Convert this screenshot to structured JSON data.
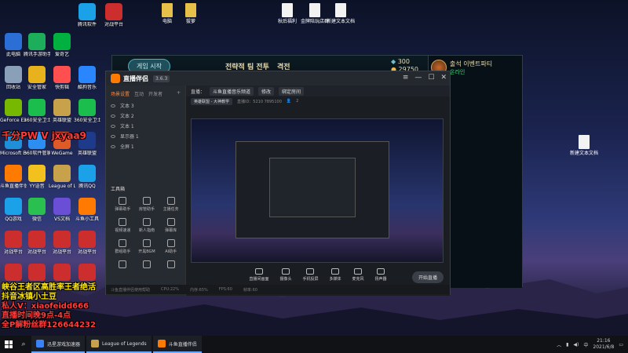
{
  "desktop": {
    "icons_col1": [
      {
        "label": "此电脑",
        "color": "#2b6fd6"
      },
      {
        "label": "回收站",
        "color": "#8aa0b8"
      },
      {
        "label": "GeForce Experience",
        "color": "#76b900"
      },
      {
        "label": "Microsoft Edge",
        "color": "#1e8fd8"
      },
      {
        "label": "斗鱼直播伴侣",
        "color": "#ff7a00"
      },
      {
        "label": "QQ游戏",
        "color": "#1aa1e8"
      },
      {
        "label": "对战平台",
        "color": "#cc2d2d"
      },
      {
        "label": "对战平台",
        "color": "#cc2d2d"
      }
    ],
    "icons_col2": [
      {
        "label": "腾讯手游助手",
        "color": "#1cae5a"
      },
      {
        "label": "安全管家",
        "color": "#e7b21c"
      },
      {
        "label": "360安全卫士",
        "color": "#1bbd4c"
      },
      {
        "label": "360软件管家",
        "color": "#2c8ef0"
      },
      {
        "label": "YY语音",
        "color": "#f2c11d"
      },
      {
        "label": "微信",
        "color": "#2ac04f"
      },
      {
        "label": "对战平台",
        "color": "#cc2d2d"
      },
      {
        "label": "对战平台",
        "color": "#cc2d2d"
      }
    ],
    "icons_col3": [
      {
        "label": "爱奇艺",
        "color": "#00b140"
      },
      {
        "label": "快剪辑",
        "color": "#ff4f4f"
      },
      {
        "label": "英雄联盟",
        "color": "#c7a24a"
      },
      {
        "label": "WeGame",
        "color": "#e05a28"
      },
      {
        "label": "League of Legends",
        "color": "#c7a24a"
      },
      {
        "label": "VS文档",
        "color": "#6a4fd6"
      },
      {
        "label": "对战平台",
        "color": "#cc2d2d"
      },
      {
        "label": "对战平台",
        "color": "#cc2d2d"
      }
    ],
    "icons_col4": [
      {
        "label": "酷狗音乐",
        "color": "#2a86ff"
      },
      {
        "label": "360安全卫士",
        "color": "#1bbd4c"
      },
      {
        "label": "英雄联盟",
        "color": "#1e3a8a"
      },
      {
        "label": "腾讯QQ",
        "color": "#1aa1e8"
      },
      {
        "label": "斗鱼小工具",
        "color": "#ff7a00"
      },
      {
        "label": "对战平台",
        "color": "#cc2d2d"
      },
      {
        "label": "对战平台",
        "color": "#cc2d2d"
      }
    ],
    "icons_top": [
      {
        "label": "腾讯软件",
        "color": "#1aa1e8"
      },
      {
        "label": "对战平台",
        "color": "#cc2d2d"
      }
    ],
    "files_top": [
      {
        "label": "电脑"
      },
      {
        "label": "拔萝"
      },
      {
        "label": "秋后福利"
      },
      {
        "label": "金牌陪玩店群"
      },
      {
        "label": "新建文本文档"
      }
    ],
    "file_right": {
      "label": "新建文本文档"
    }
  },
  "overlay": {
    "line1": "千分PW V jxyaa9",
    "line2": "峡谷王者区高胜率王者绝活",
    "line3": "抖音冰镇小土豆",
    "line4": "私人V：xiaofeidd666",
    "line5": "直播时间晚9点-4点",
    "line6": "全P解粉丝群126644232"
  },
  "game_client": {
    "play_button": "게임 시작",
    "nav_items": [
      "전략적 팀 전투",
      "격전"
    ],
    "currency_be": "300",
    "currency_rp": "29750",
    "player_name": "출석 이벤트파티",
    "player_status": "온라인"
  },
  "stream_app": {
    "brand": "直播伴侣",
    "badge": "3.6.3",
    "tabs": [
      "场景设置",
      "互动",
      "开发者"
    ],
    "scenes": [
      "文本 3",
      "文本 2",
      "文本 1",
      "显示器 1",
      "全屏 1"
    ],
    "live_title_label": "直播：",
    "live_title": "斗鱼直播音乐频道",
    "edit_chip": "修改",
    "room_chip": "绑定房间",
    "category": "英雄联盟 - 大神教学",
    "room_id": "直播ID：5210  7895100",
    "viewers_label": "2",
    "tools_label": "工具箱",
    "tools": [
      "弹幕助手",
      "房管助手",
      "主播任务",
      "视频速递",
      "新人指南",
      "弹幕库",
      "群组助手",
      "开黑BGM",
      "AI助手",
      "",
      "",
      ""
    ],
    "bottom_buttons": [
      "直播间画面",
      "摄像头",
      "手机投屏",
      "多媒体",
      "麦克风",
      "扬声器"
    ],
    "go_live": "开始直播",
    "status_items": [
      "斗鱼直播伴侣使用帮助",
      "CPU:22%",
      "内存:65%",
      "FPS:60",
      "帧率:60"
    ]
  },
  "taskbar": {
    "apps": [
      {
        "label": "迅星游戏加速器",
        "color": "#3b82f6"
      },
      {
        "label": "League of Legends",
        "color": "#c7a24a"
      },
      {
        "label": "斗鱼直播伴侣",
        "color": "#ff7a00"
      }
    ],
    "time": "21:16",
    "date": "2021/6/8",
    "lang": "中"
  }
}
